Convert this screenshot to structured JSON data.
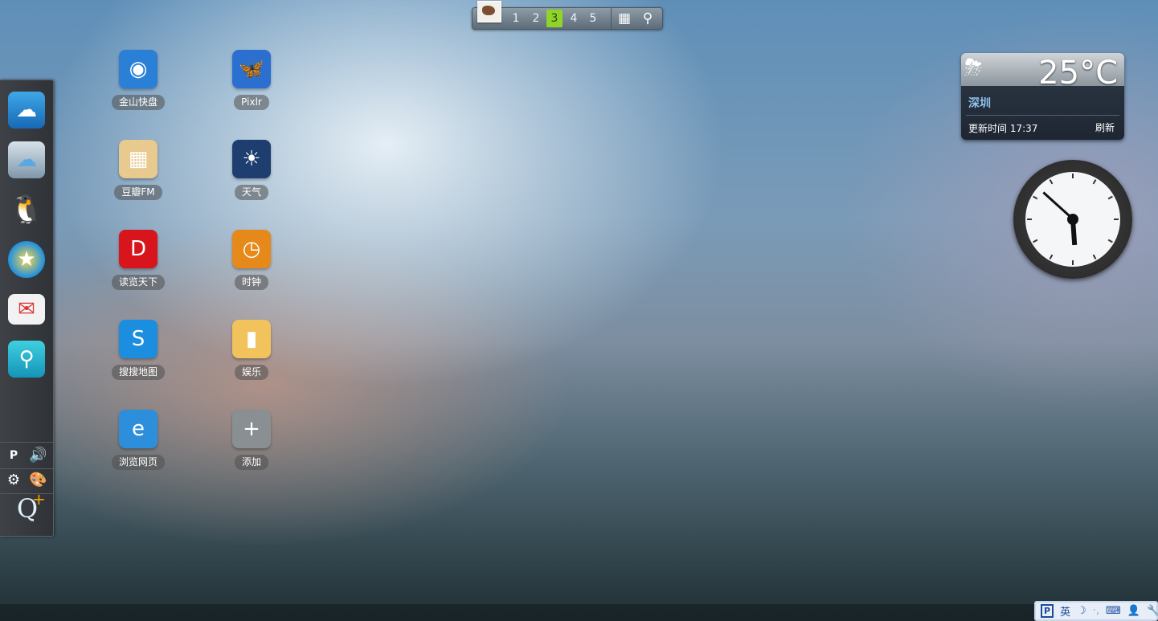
{
  "topbar": {
    "pages": [
      "1",
      "2",
      "3",
      "4",
      "5"
    ],
    "active_page": "3",
    "icons": [
      "grid-icon",
      "search-icon"
    ]
  },
  "dock": {
    "apps": [
      {
        "name": "app-store",
        "icon": "shopping-bag-cloud-icon"
      },
      {
        "name": "cloud-drive",
        "icon": "cloud-drive-icon"
      },
      {
        "name": "qq",
        "icon": "penguin-icon"
      },
      {
        "name": "qzone",
        "icon": "star-z-icon"
      },
      {
        "name": "qq-mail",
        "icon": "mail-icon"
      },
      {
        "name": "qq-browser-search",
        "icon": "pin-search-icon"
      }
    ],
    "tools": [
      "pinyin-icon",
      "volume-icon",
      "gear-icon",
      "palette-icon",
      "q-plus-icon"
    ]
  },
  "desktop": {
    "apps": [
      {
        "label": "金山快盘",
        "color": "#2a7fd6"
      },
      {
        "label": "Pixlr",
        "color": "#2b6fd1"
      },
      {
        "label": "豆瓣FM",
        "color": "#e8c98e"
      },
      {
        "label": "天气",
        "color": "#1d3e6e"
      },
      {
        "label": "读览天下",
        "color": "#d8151c"
      },
      {
        "label": "时钟",
        "color": "#e58a1a"
      },
      {
        "label": "搜搜地图",
        "color": "#1b8ee0"
      },
      {
        "label": "娱乐",
        "color": "#f2c35c"
      },
      {
        "label": "浏览网页",
        "color": "#2d8fdc"
      },
      {
        "label": "添加",
        "color": "#8a8f93"
      }
    ]
  },
  "weather": {
    "temperature": "25°C",
    "city": "深圳",
    "update_label": "更新时间",
    "update_time": "17:37",
    "refresh": "刷新",
    "condition_icon": "thunderstorm-icon"
  },
  "clock": {
    "time": "17:52"
  },
  "ime": {
    "mode": "英",
    "icons": [
      "pinyin-logo-icon",
      "moon-icon",
      "punctuation-icon",
      "keyboard-icon",
      "user-icon",
      "wrench-icon"
    ]
  }
}
